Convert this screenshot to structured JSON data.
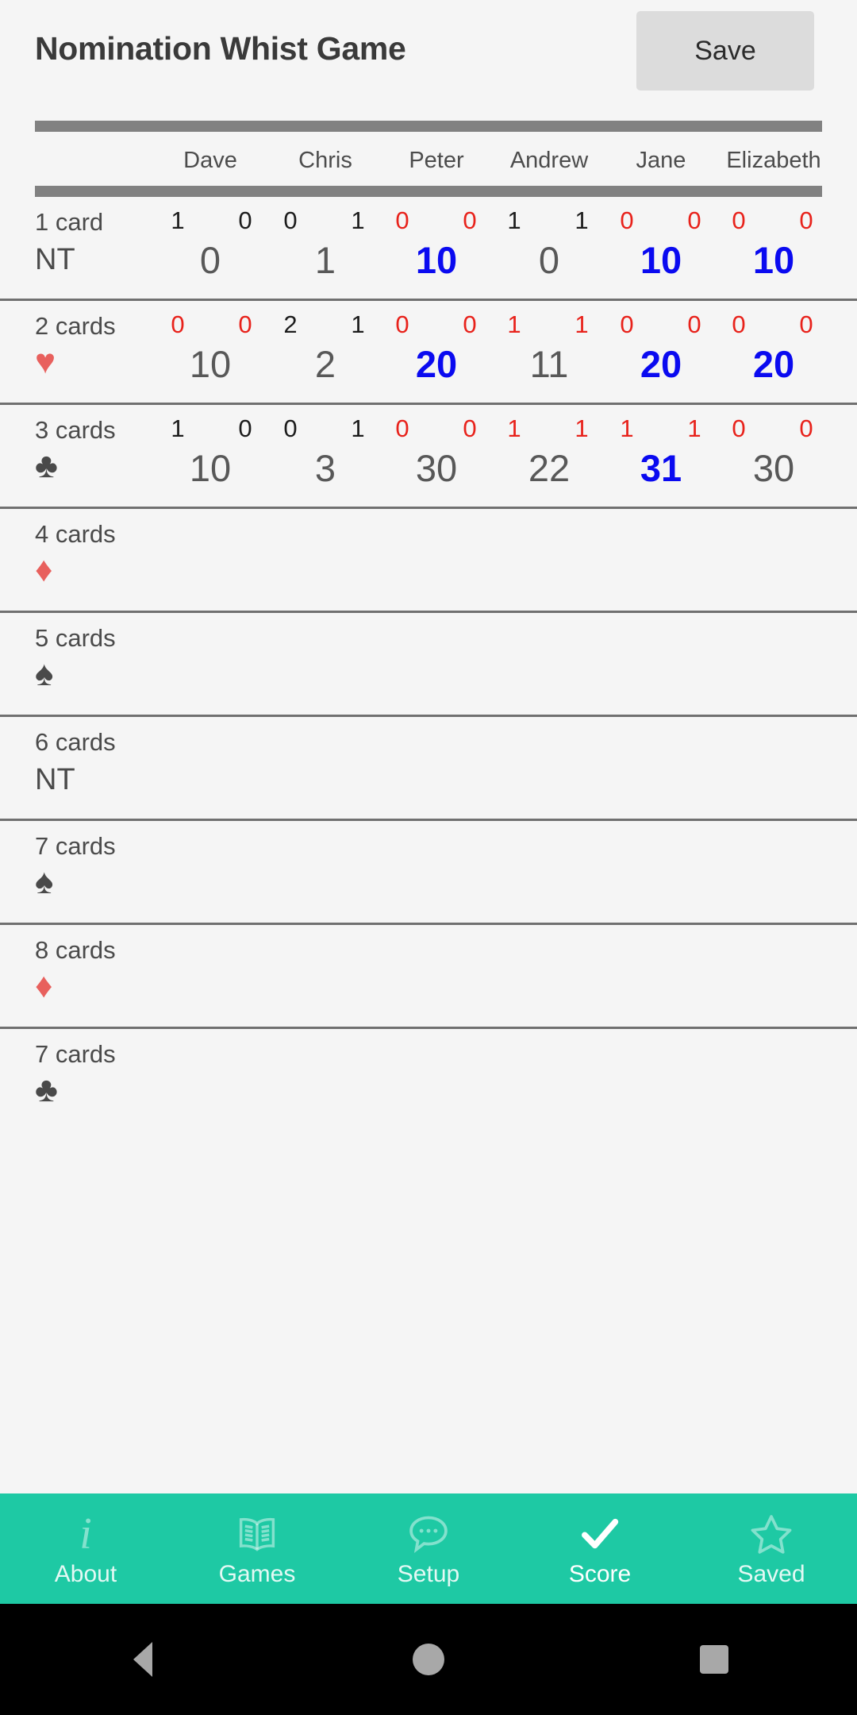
{
  "header": {
    "title": "Nomination Whist Game",
    "save_label": "Save"
  },
  "players": [
    "Dave",
    "Chris",
    "Peter",
    "Andrew",
    "Jane",
    "Elizabeth"
  ],
  "colors": {
    "accent": "#1ec9a4",
    "hit": "#0a0af0",
    "miss": "#e8221b",
    "red_suit": "#e8605d",
    "black_suit": "#4a4a4a",
    "rule": "#818181",
    "background": "#f5f5f5"
  },
  "rounds": [
    {
      "label": "1 card",
      "suit_name": "no-trumps",
      "suit_glyph": "NT",
      "suit_color": "black",
      "bids": [
        "1",
        "0",
        "0",
        "1",
        "0",
        "0"
      ],
      "tricks": [
        "0",
        "1",
        "0",
        "1",
        "0",
        "0"
      ],
      "bid_miss": [
        false,
        false,
        true,
        false,
        true,
        true
      ],
      "trick_miss": [
        false,
        false,
        true,
        false,
        true,
        true
      ],
      "totals": [
        "0",
        "1",
        "10",
        "0",
        "10",
        "10"
      ],
      "total_hit": [
        false,
        false,
        true,
        false,
        true,
        true
      ]
    },
    {
      "label": "2 cards",
      "suit_name": "hearts",
      "suit_glyph": "♥",
      "suit_color": "red",
      "bids": [
        "0",
        "2",
        "0",
        "1",
        "0",
        "0"
      ],
      "tricks": [
        "0",
        "1",
        "0",
        "1",
        "0",
        "0"
      ],
      "bid_miss": [
        true,
        false,
        true,
        true,
        true,
        true
      ],
      "trick_miss": [
        true,
        false,
        true,
        true,
        true,
        true
      ],
      "totals": [
        "10",
        "2",
        "20",
        "11",
        "20",
        "20"
      ],
      "total_hit": [
        false,
        false,
        true,
        false,
        true,
        true
      ]
    },
    {
      "label": "3 cards",
      "suit_name": "clubs",
      "suit_glyph": "♣",
      "suit_color": "black",
      "bids": [
        "1",
        "0",
        "0",
        "1",
        "1",
        "0"
      ],
      "tricks": [
        "0",
        "1",
        "0",
        "1",
        "1",
        "0"
      ],
      "bid_miss": [
        false,
        false,
        true,
        true,
        true,
        true
      ],
      "trick_miss": [
        false,
        false,
        true,
        true,
        true,
        true
      ],
      "totals": [
        "10",
        "3",
        "30",
        "22",
        "31",
        "30"
      ],
      "total_hit": [
        false,
        false,
        false,
        false,
        true,
        false
      ]
    },
    {
      "label": "4 cards",
      "suit_name": "diamonds",
      "suit_glyph": "♦",
      "suit_color": "red",
      "bids": [
        "",
        "",
        "",
        "",
        "",
        ""
      ],
      "tricks": [
        "",
        "",
        "",
        "",
        "",
        ""
      ],
      "bid_miss": [
        false,
        false,
        false,
        false,
        false,
        false
      ],
      "trick_miss": [
        false,
        false,
        false,
        false,
        false,
        false
      ],
      "totals": [
        "",
        "",
        "",
        "",
        "",
        ""
      ],
      "total_hit": [
        false,
        false,
        false,
        false,
        false,
        false
      ]
    },
    {
      "label": "5 cards",
      "suit_name": "spades",
      "suit_glyph": "♠",
      "suit_color": "black",
      "bids": [
        "",
        "",
        "",
        "",
        "",
        ""
      ],
      "tricks": [
        "",
        "",
        "",
        "",
        "",
        ""
      ],
      "bid_miss": [
        false,
        false,
        false,
        false,
        false,
        false
      ],
      "trick_miss": [
        false,
        false,
        false,
        false,
        false,
        false
      ],
      "totals": [
        "",
        "",
        "",
        "",
        "",
        ""
      ],
      "total_hit": [
        false,
        false,
        false,
        false,
        false,
        false
      ]
    },
    {
      "label": "6 cards",
      "suit_name": "no-trumps",
      "suit_glyph": "NT",
      "suit_color": "black",
      "bids": [
        "",
        "",
        "",
        "",
        "",
        ""
      ],
      "tricks": [
        "",
        "",
        "",
        "",
        "",
        ""
      ],
      "bid_miss": [
        false,
        false,
        false,
        false,
        false,
        false
      ],
      "trick_miss": [
        false,
        false,
        false,
        false,
        false,
        false
      ],
      "totals": [
        "",
        "",
        "",
        "",
        "",
        ""
      ],
      "total_hit": [
        false,
        false,
        false,
        false,
        false,
        false
      ]
    },
    {
      "label": "7 cards",
      "suit_name": "spades",
      "suit_glyph": "♠",
      "suit_color": "black",
      "bids": [
        "",
        "",
        "",
        "",
        "",
        ""
      ],
      "tricks": [
        "",
        "",
        "",
        "",
        "",
        ""
      ],
      "bid_miss": [
        false,
        false,
        false,
        false,
        false,
        false
      ],
      "trick_miss": [
        false,
        false,
        false,
        false,
        false,
        false
      ],
      "totals": [
        "",
        "",
        "",
        "",
        "",
        ""
      ],
      "total_hit": [
        false,
        false,
        false,
        false,
        false,
        false
      ]
    },
    {
      "label": "8 cards",
      "suit_name": "diamonds",
      "suit_glyph": "♦",
      "suit_color": "red",
      "bids": [
        "",
        "",
        "",
        "",
        "",
        ""
      ],
      "tricks": [
        "",
        "",
        "",
        "",
        "",
        ""
      ],
      "bid_miss": [
        false,
        false,
        false,
        false,
        false,
        false
      ],
      "trick_miss": [
        false,
        false,
        false,
        false,
        false,
        false
      ],
      "totals": [
        "",
        "",
        "",
        "",
        "",
        ""
      ],
      "total_hit": [
        false,
        false,
        false,
        false,
        false,
        false
      ]
    },
    {
      "label": "7 cards",
      "suit_name": "clubs",
      "suit_glyph": "♣",
      "suit_color": "black",
      "bids": [
        "",
        "",
        "",
        "",
        "",
        ""
      ],
      "tricks": [
        "",
        "",
        "",
        "",
        "",
        ""
      ],
      "bid_miss": [
        false,
        false,
        false,
        false,
        false,
        false
      ],
      "trick_miss": [
        false,
        false,
        false,
        false,
        false,
        false
      ],
      "totals": [
        "",
        "",
        "",
        "",
        "",
        ""
      ],
      "total_hit": [
        false,
        false,
        false,
        false,
        false,
        false
      ]
    }
  ],
  "tabbar": {
    "items": [
      {
        "label": "About",
        "icon": "info-icon",
        "active": false
      },
      {
        "label": "Games",
        "icon": "book-icon",
        "active": false
      },
      {
        "label": "Setup",
        "icon": "speech-bubble-icon",
        "active": false
      },
      {
        "label": "Score",
        "icon": "check-icon",
        "active": true
      },
      {
        "label": "Saved",
        "icon": "star-icon",
        "active": false
      }
    ]
  },
  "system_nav": {
    "back": "back-button",
    "home": "home-button",
    "recents": "recents-button"
  }
}
